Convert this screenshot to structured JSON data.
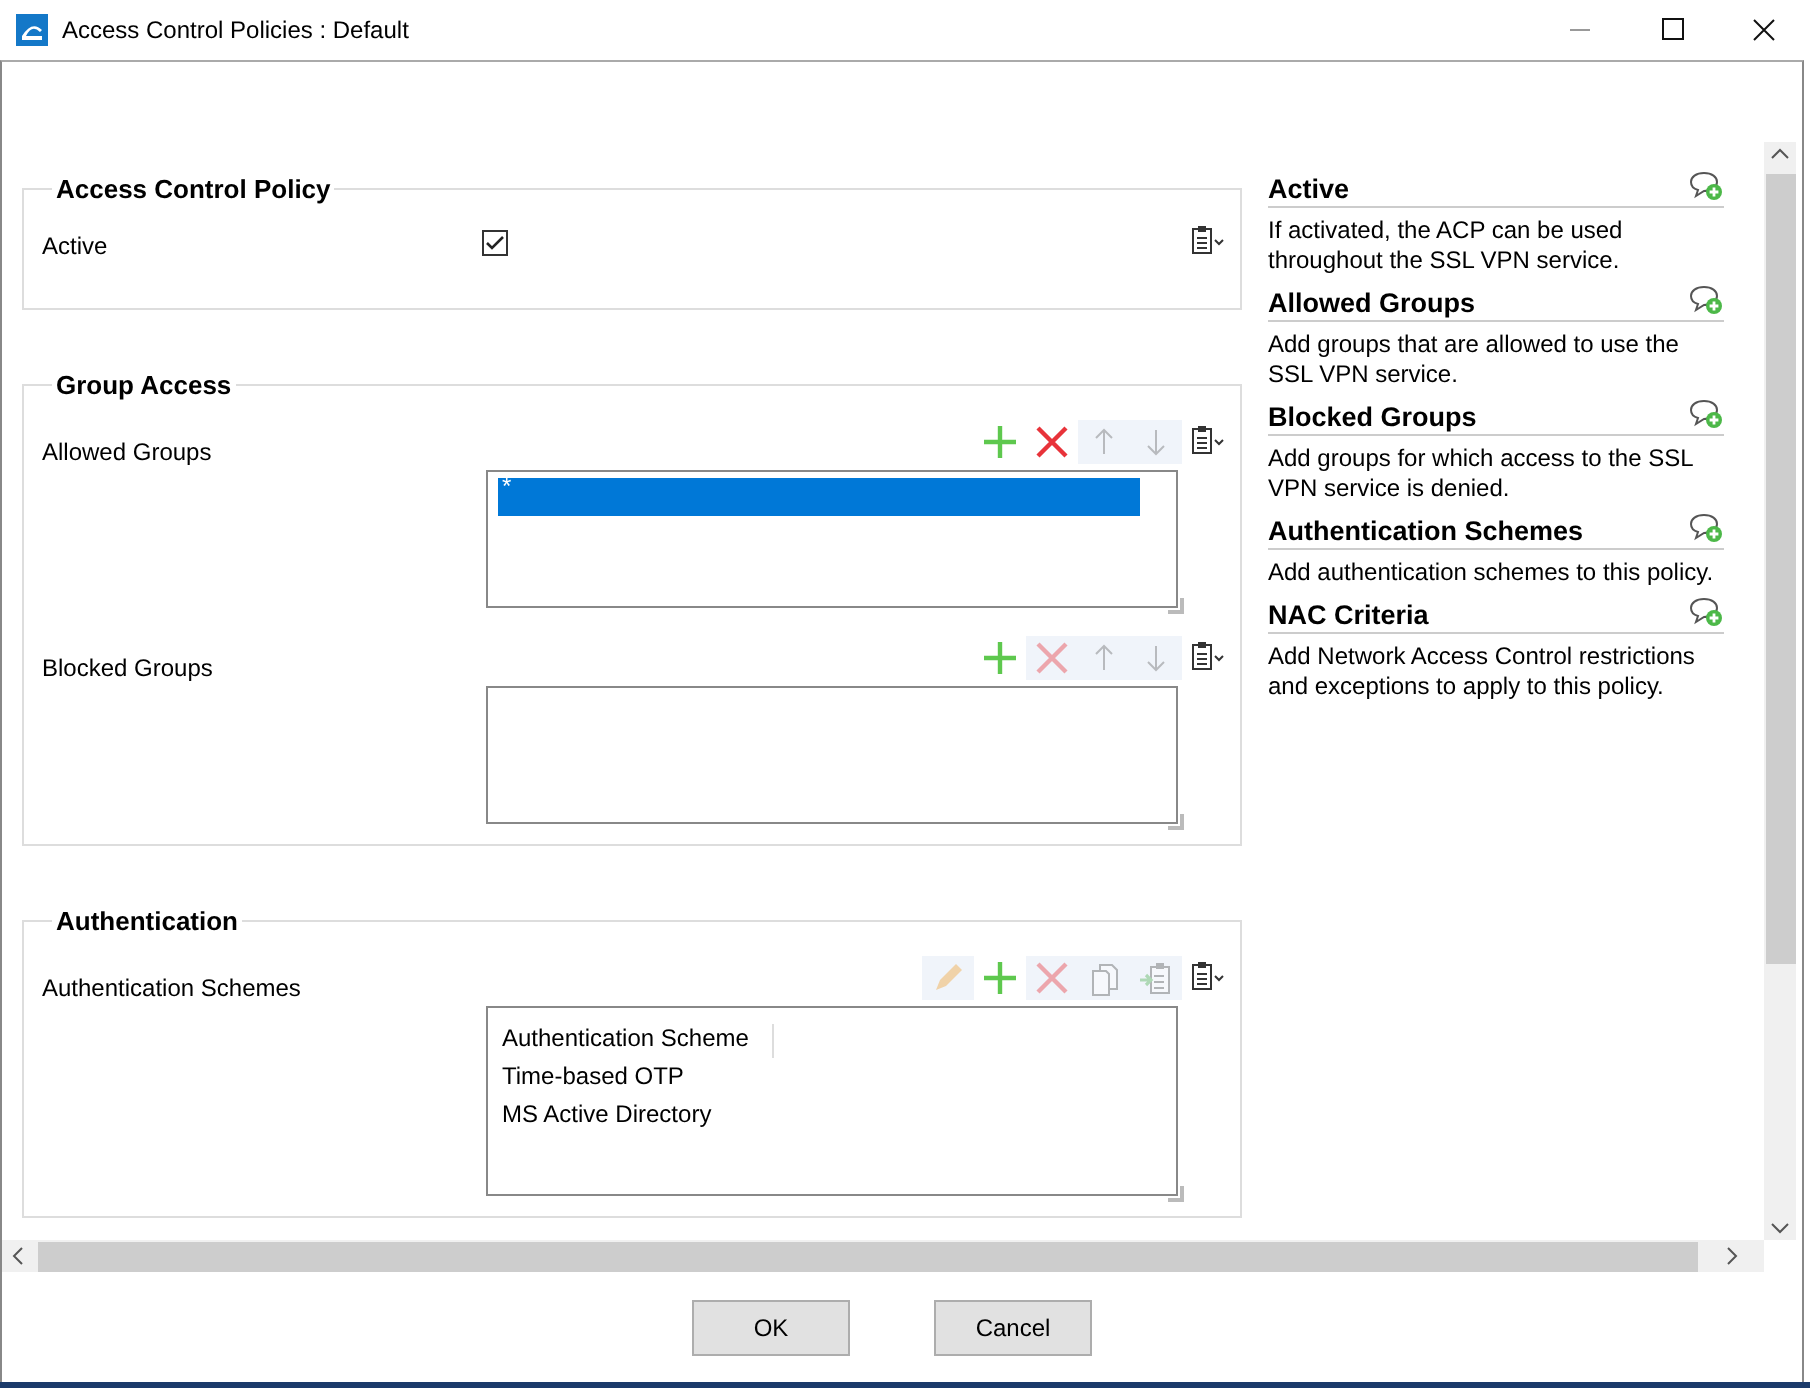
{
  "window": {
    "title": "Access Control Policies : Default"
  },
  "sections": [
    {
      "title": "Access Control Policy",
      "fields": [
        {
          "kind": "checkbox",
          "label": "Active",
          "checked": true
        }
      ]
    },
    {
      "title": "Group Access",
      "fields": [
        {
          "kind": "list",
          "label": "Allowed Groups",
          "tools": [
            {
              "kind": "add",
              "disabled": false
            },
            {
              "kind": "delete",
              "disabled": false
            },
            {
              "kind": "up",
              "disabled": true
            },
            {
              "kind": "down",
              "disabled": true
            }
          ],
          "rows": [
            {
              "text": "*",
              "selected": true
            }
          ]
        },
        {
          "kind": "list",
          "label": "Blocked Groups",
          "tools": [
            {
              "kind": "add",
              "disabled": false
            },
            {
              "kind": "delete",
              "disabled": true
            },
            {
              "kind": "up",
              "disabled": true
            },
            {
              "kind": "down",
              "disabled": true
            }
          ]
        }
      ]
    },
    {
      "title": "Authentication",
      "fields": [
        {
          "kind": "list",
          "label": "Authentication Schemes",
          "tools": [
            {
              "kind": "edit",
              "disabled": true
            },
            {
              "kind": "add",
              "disabled": false
            },
            {
              "kind": "delete",
              "disabled": true
            },
            {
              "kind": "copy",
              "disabled": true
            },
            {
              "kind": "import",
              "disabled": true
            }
          ],
          "header": "Authentication Scheme",
          "rows": [
            {
              "text": "Time-based OTP",
              "selected": false
            },
            {
              "text": "MS Active Directory",
              "selected": false
            }
          ]
        }
      ]
    }
  ],
  "help": [
    {
      "title": "Active",
      "text": "If activated, the ACP can be used throughout the SSL VPN service."
    },
    {
      "title": "Allowed Groups",
      "text": "Add groups that are allowed to use the SSL VPN service."
    },
    {
      "title": "Blocked Groups",
      "text": "Add groups for which access to the SSL VPN service is denied."
    },
    {
      "title": "Authentication Schemes",
      "text": "Add authentication schemes to this policy."
    },
    {
      "title": "NAC Criteria",
      "text": "Add Network Access Control restrictions and exceptions to apply to this policy."
    }
  ],
  "buttons": [
    "OK",
    "Cancel"
  ]
}
